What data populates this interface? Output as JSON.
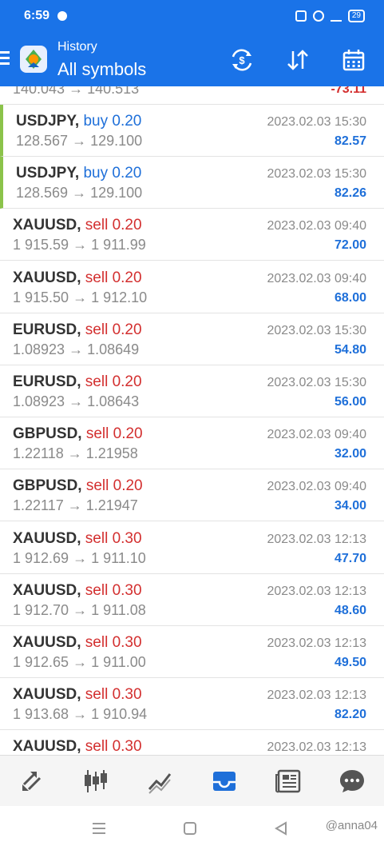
{
  "status": {
    "time": "6:59",
    "battery": "29"
  },
  "header": {
    "subtitle": "History",
    "title": "All symbols"
  },
  "partial_top": {
    "prices": "140.043 → 140.513",
    "profit": "-73.11"
  },
  "trades": [
    {
      "symbol": "USDJPY,",
      "dir": "buy",
      "qty": "buy 0.20",
      "prices": "128.567 → 129.100",
      "datetime": "2023.02.03 15:30",
      "profit": "82.57"
    },
    {
      "symbol": "USDJPY,",
      "dir": "buy",
      "qty": "buy 0.20",
      "prices": "128.569 → 129.100",
      "datetime": "2023.02.03 15:30",
      "profit": "82.26"
    },
    {
      "symbol": "XAUUSD,",
      "dir": "sell",
      "qty": "sell 0.20",
      "prices": "1 915.59 → 1 911.99",
      "datetime": "2023.02.03 09:40",
      "profit": "72.00"
    },
    {
      "symbol": "XAUUSD,",
      "dir": "sell",
      "qty": "sell 0.20",
      "prices": "1 915.50 → 1 912.10",
      "datetime": "2023.02.03 09:40",
      "profit": "68.00"
    },
    {
      "symbol": "EURUSD,",
      "dir": "sell",
      "qty": "sell 0.20",
      "prices": "1.08923 → 1.08649",
      "datetime": "2023.02.03 15:30",
      "profit": "54.80"
    },
    {
      "symbol": "EURUSD,",
      "dir": "sell",
      "qty": "sell 0.20",
      "prices": "1.08923 → 1.08643",
      "datetime": "2023.02.03 15:30",
      "profit": "56.00"
    },
    {
      "symbol": "GBPUSD,",
      "dir": "sell",
      "qty": "sell 0.20",
      "prices": "1.22118 → 1.21958",
      "datetime": "2023.02.03 09:40",
      "profit": "32.00"
    },
    {
      "symbol": "GBPUSD,",
      "dir": "sell",
      "qty": "sell 0.20",
      "prices": "1.22117 → 1.21947",
      "datetime": "2023.02.03 09:40",
      "profit": "34.00"
    },
    {
      "symbol": "XAUUSD,",
      "dir": "sell",
      "qty": "sell 0.30",
      "prices": "1 912.69 → 1 911.10",
      "datetime": "2023.02.03 12:13",
      "profit": "47.70"
    },
    {
      "symbol": "XAUUSD,",
      "dir": "sell",
      "qty": "sell 0.30",
      "prices": "1 912.70 → 1 911.08",
      "datetime": "2023.02.03 12:13",
      "profit": "48.60"
    },
    {
      "symbol": "XAUUSD,",
      "dir": "sell",
      "qty": "sell 0.30",
      "prices": "1 912.65 → 1 911.00",
      "datetime": "2023.02.03 12:13",
      "profit": "49.50"
    },
    {
      "symbol": "XAUUSD,",
      "dir": "sell",
      "qty": "sell 0.30",
      "prices": "1 913.68 → 1 910.94",
      "datetime": "2023.02.03 12:13",
      "profit": "82.20"
    }
  ],
  "partial_bottom": {
    "symbol": "XAUUSD,",
    "qty": "sell 0.30",
    "datetime": "2023.02.03 12:13"
  },
  "watermark": "@anna04",
  "colors": {
    "primary": "#1a73e8",
    "buy": "#1e6fd9",
    "sell": "#d32f2f",
    "accent": "#8bc34a"
  }
}
